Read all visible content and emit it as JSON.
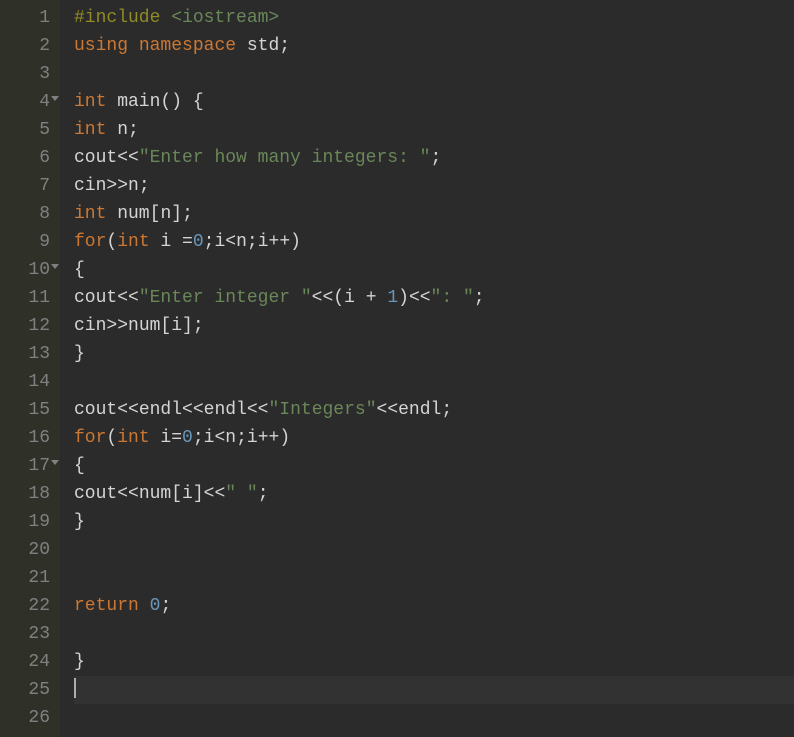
{
  "gutter": {
    "lines": [
      "1",
      "2",
      "3",
      "4",
      "5",
      "6",
      "7",
      "8",
      "9",
      "10",
      "11",
      "12",
      "13",
      "14",
      "15",
      "16",
      "17",
      "18",
      "19",
      "20",
      "21",
      "22",
      "23",
      "24",
      "25",
      "26"
    ],
    "foldLines": [
      4,
      10,
      17
    ]
  },
  "code": {
    "lines": [
      [
        {
          "t": "#include ",
          "c": "macro"
        },
        {
          "t": "<iostream>",
          "c": "include-path"
        }
      ],
      [
        {
          "t": "using",
          "c": "kw"
        },
        {
          "t": " ",
          "c": "id"
        },
        {
          "t": "namespace",
          "c": "kw"
        },
        {
          "t": " std",
          "c": "id"
        },
        {
          "t": ";",
          "c": "punct"
        }
      ],
      [],
      [
        {
          "t": "int",
          "c": "type"
        },
        {
          "t": " main",
          "c": "id"
        },
        {
          "t": "()",
          "c": "punct"
        },
        {
          "t": " ",
          "c": "id"
        },
        {
          "t": "{",
          "c": "punct"
        }
      ],
      [
        {
          "t": "int",
          "c": "type"
        },
        {
          "t": " n",
          "c": "id"
        },
        {
          "t": ";",
          "c": "punct"
        }
      ],
      [
        {
          "t": "cout",
          "c": "id"
        },
        {
          "t": "<<",
          "c": "op"
        },
        {
          "t": "\"Enter how many integers: \"",
          "c": "str"
        },
        {
          "t": ";",
          "c": "punct"
        }
      ],
      [
        {
          "t": "cin",
          "c": "id"
        },
        {
          "t": ">>",
          "c": "op"
        },
        {
          "t": "n",
          "c": "id"
        },
        {
          "t": ";",
          "c": "punct"
        }
      ],
      [
        {
          "t": "int",
          "c": "type"
        },
        {
          "t": " num",
          "c": "id"
        },
        {
          "t": "[",
          "c": "punct"
        },
        {
          "t": "n",
          "c": "id"
        },
        {
          "t": "]",
          "c": "punct"
        },
        {
          "t": ";",
          "c": "punct"
        }
      ],
      [
        {
          "t": "for",
          "c": "kw"
        },
        {
          "t": "(",
          "c": "punct"
        },
        {
          "t": "int",
          "c": "type"
        },
        {
          "t": " i ",
          "c": "id"
        },
        {
          "t": "=",
          "c": "op"
        },
        {
          "t": "0",
          "c": "num"
        },
        {
          "t": ";",
          "c": "punct"
        },
        {
          "t": "i",
          "c": "id"
        },
        {
          "t": "<",
          "c": "op"
        },
        {
          "t": "n",
          "c": "id"
        },
        {
          "t": ";",
          "c": "punct"
        },
        {
          "t": "i",
          "c": "id"
        },
        {
          "t": "++",
          "c": "op"
        },
        {
          "t": ")",
          "c": "punct"
        }
      ],
      [
        {
          "t": "{",
          "c": "punct"
        }
      ],
      [
        {
          "t": "cout",
          "c": "id"
        },
        {
          "t": "<<",
          "c": "op"
        },
        {
          "t": "\"Enter integer \"",
          "c": "str"
        },
        {
          "t": "<<",
          "c": "op"
        },
        {
          "t": "(",
          "c": "punct"
        },
        {
          "t": "i ",
          "c": "id"
        },
        {
          "t": "+",
          "c": "op"
        },
        {
          "t": " ",
          "c": "id"
        },
        {
          "t": "1",
          "c": "num"
        },
        {
          "t": ")",
          "c": "punct"
        },
        {
          "t": "<<",
          "c": "op"
        },
        {
          "t": "\": \"",
          "c": "str"
        },
        {
          "t": ";",
          "c": "punct"
        }
      ],
      [
        {
          "t": "cin",
          "c": "id"
        },
        {
          "t": ">>",
          "c": "op"
        },
        {
          "t": "num",
          "c": "id"
        },
        {
          "t": "[",
          "c": "punct"
        },
        {
          "t": "i",
          "c": "id"
        },
        {
          "t": "]",
          "c": "punct"
        },
        {
          "t": ";",
          "c": "punct"
        }
      ],
      [
        {
          "t": "}",
          "c": "punct"
        }
      ],
      [],
      [
        {
          "t": "cout",
          "c": "id"
        },
        {
          "t": "<<",
          "c": "op"
        },
        {
          "t": "endl",
          "c": "id"
        },
        {
          "t": "<<",
          "c": "op"
        },
        {
          "t": "endl",
          "c": "id"
        },
        {
          "t": "<<",
          "c": "op"
        },
        {
          "t": "\"Integers\"",
          "c": "str"
        },
        {
          "t": "<<",
          "c": "op"
        },
        {
          "t": "endl",
          "c": "id"
        },
        {
          "t": ";",
          "c": "punct"
        }
      ],
      [
        {
          "t": "for",
          "c": "kw"
        },
        {
          "t": "(",
          "c": "punct"
        },
        {
          "t": "int",
          "c": "type"
        },
        {
          "t": " i",
          "c": "id"
        },
        {
          "t": "=",
          "c": "op"
        },
        {
          "t": "0",
          "c": "num"
        },
        {
          "t": ";",
          "c": "punct"
        },
        {
          "t": "i",
          "c": "id"
        },
        {
          "t": "<",
          "c": "op"
        },
        {
          "t": "n",
          "c": "id"
        },
        {
          "t": ";",
          "c": "punct"
        },
        {
          "t": "i",
          "c": "id"
        },
        {
          "t": "++",
          "c": "op"
        },
        {
          "t": ")",
          "c": "punct"
        }
      ],
      [
        {
          "t": "{",
          "c": "punct"
        }
      ],
      [
        {
          "t": "cout",
          "c": "id"
        },
        {
          "t": "<<",
          "c": "op"
        },
        {
          "t": "num",
          "c": "id"
        },
        {
          "t": "[",
          "c": "punct"
        },
        {
          "t": "i",
          "c": "id"
        },
        {
          "t": "]",
          "c": "punct"
        },
        {
          "t": "<<",
          "c": "op"
        },
        {
          "t": "\" \"",
          "c": "str"
        },
        {
          "t": ";",
          "c": "punct"
        }
      ],
      [
        {
          "t": "}",
          "c": "punct"
        }
      ],
      [],
      [],
      [
        {
          "t": "return",
          "c": "kw"
        },
        {
          "t": " ",
          "c": "id"
        },
        {
          "t": "0",
          "c": "num"
        },
        {
          "t": ";",
          "c": "punct"
        }
      ],
      [],
      [
        {
          "t": "}",
          "c": "punct"
        }
      ],
      [],
      []
    ],
    "activeLine": 25,
    "cursorLine": 25
  }
}
